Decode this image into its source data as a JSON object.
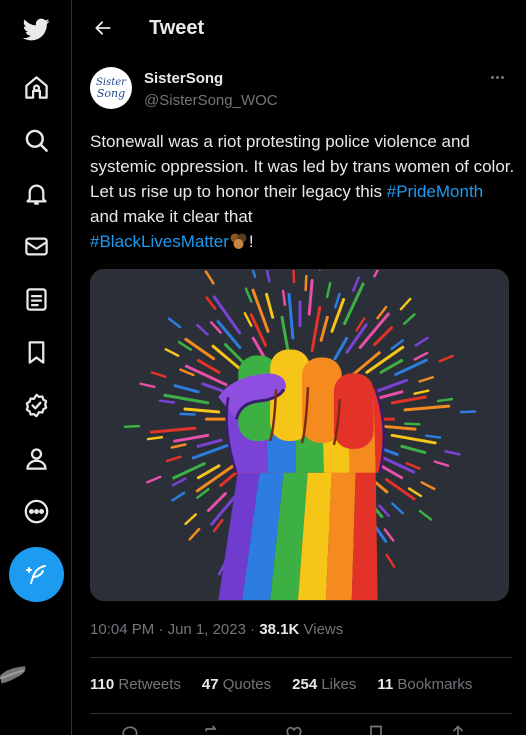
{
  "header": {
    "title": "Tweet"
  },
  "nav": {
    "items": [
      {
        "icon": "twitter-logo-icon"
      },
      {
        "icon": "home-icon"
      },
      {
        "icon": "explore-icon"
      },
      {
        "icon": "notifications-icon"
      },
      {
        "icon": "messages-icon"
      },
      {
        "icon": "lists-icon"
      },
      {
        "icon": "bookmarks-icon"
      },
      {
        "icon": "verified-icon"
      },
      {
        "icon": "profile-icon"
      },
      {
        "icon": "more-icon"
      }
    ],
    "compose_icon": "compose-tweet-icon"
  },
  "author": {
    "name": "SisterSong",
    "handle": "@SisterSong_WOC",
    "avatar_line1": "Sister",
    "avatar_line2": "Song"
  },
  "tweet": {
    "text_part1": "Stonewall was a riot protesting police violence and systemic oppression. It was led by trans women of color.  Let us rise up to honor their legacy this ",
    "hashtag1": "#PrideMonth",
    "text_part2": " and make it clear that ",
    "hashtag2": "#BlackLivesMatter",
    "text_part3": "!",
    "media_description_icon": "rainbow-fist-image"
  },
  "meta": {
    "time": "10:04 PM",
    "date": "Jun 1, 2023",
    "views_count": "38.1K",
    "views_label": "Views"
  },
  "stats": {
    "retweets_count": "110",
    "retweets_label": "Retweets",
    "quotes_count": "47",
    "quotes_label": "Quotes",
    "likes_count": "254",
    "likes_label": "Likes",
    "bookmarks_count": "11",
    "bookmarks_label": "Bookmarks"
  },
  "colors": {
    "background": "#000000",
    "accent": "#1d9bf0",
    "text": "#e7e9ea",
    "muted": "#71767b",
    "divider": "#2f3336"
  }
}
